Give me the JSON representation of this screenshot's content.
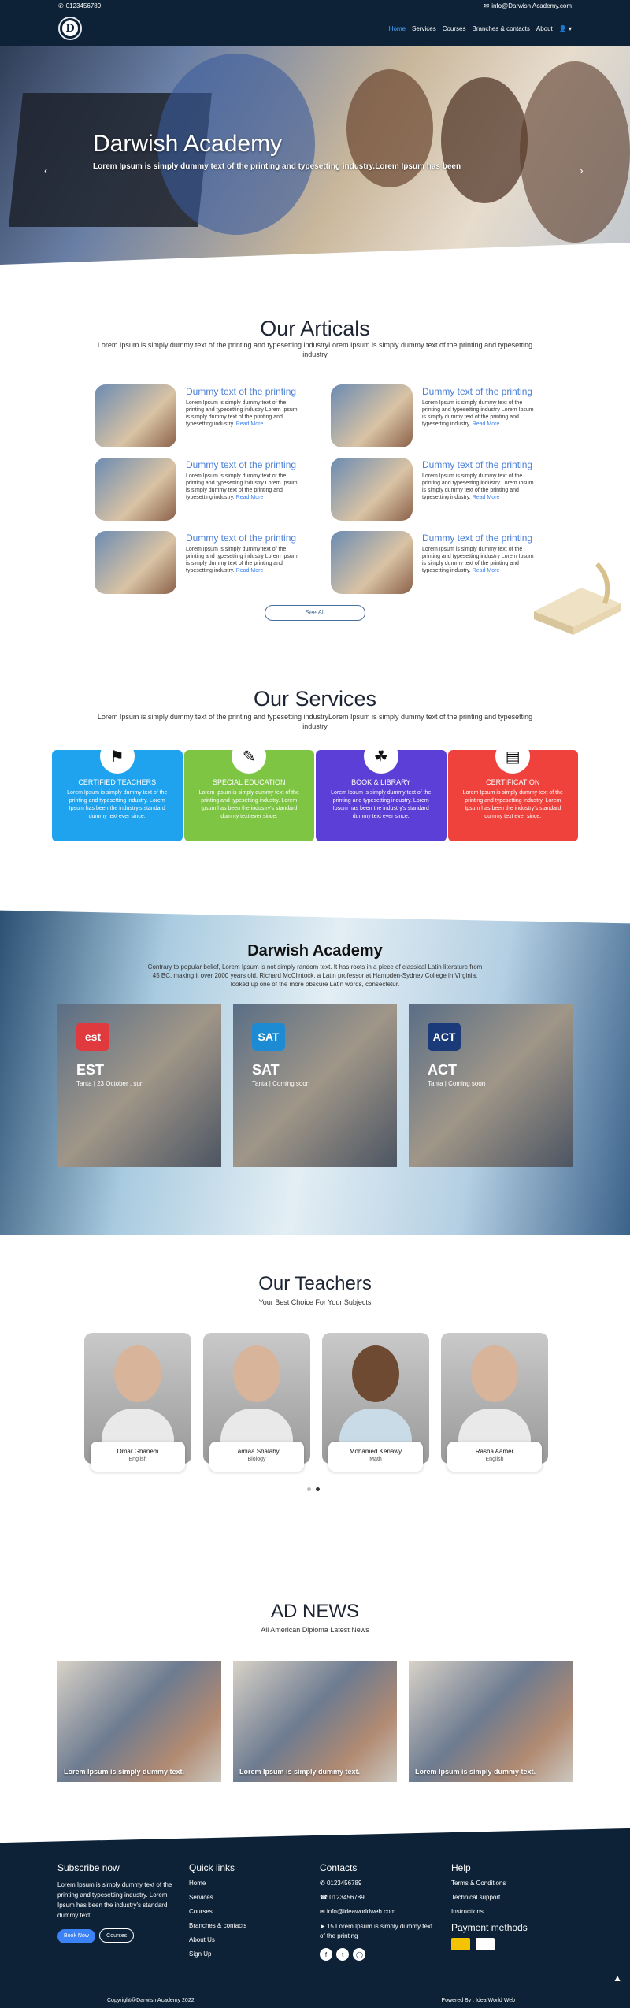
{
  "topbar": {
    "phone": "0123456789",
    "email": "info@Darwish Academy.com"
  },
  "nav": {
    "logo_letter": "D",
    "items": [
      "Home",
      "Services",
      "Courses",
      "Branches & contacts",
      "About"
    ],
    "user_icon": "user-icon"
  },
  "hero": {
    "title": "Darwish Academy",
    "subtitle": "Lorem Ipsum is simply dummy text of the printing and typesetting industry.Lorem Ipsum has been"
  },
  "articles": {
    "title": "Our Articals",
    "subtitle": "Lorem Ipsum is simply dummy text of the printing and typesetting industryLorem Ipsum is simply dummy text of the printing and typesetting industry",
    "items": [
      {
        "title": "Dummy text of the printing",
        "text": "Lorem Ipsum is simply dummy text of the printing and typesetting industry Lorem Ipsum is simply dummy text of the printing and typesetting industry.",
        "link": "Read More"
      },
      {
        "title": "Dummy text of the printing",
        "text": "Lorem Ipsum is simply dummy text of the printing and typesetting industry Lorem Ipsum is simply dummy text of the printing and typesetting industry.",
        "link": "Read More"
      },
      {
        "title": "Dummy text of the printing",
        "text": "Lorem Ipsum is simply dummy text of the printing and typesetting industry Lorem Ipsum is simply dummy text of the printing and typesetting industry.",
        "link": "Read More"
      },
      {
        "title": "Dummy text of the printing",
        "text": "Lorem Ipsum is simply dummy text of the printing and typesetting industry Lorem Ipsum is simply dummy text of the printing and typesetting industry.",
        "link": "Read More"
      },
      {
        "title": "Dummy text of the printing",
        "text": "Lorem Ipsum is simply dummy text of the printing and typesetting industry Lorem Ipsum is simply dummy text of the printing and typesetting industry.",
        "link": "Read More"
      },
      {
        "title": "Dummy text of the printing",
        "text": "Lorem Ipsum is simply dummy text of the printing and typesetting industry Lorem Ipsum is simply dummy text of the printing and typesetting industry.",
        "link": "Read More"
      }
    ],
    "see_all": "See All"
  },
  "services": {
    "title": "Our Services",
    "subtitle": "Lorem Ipsum is simply dummy text of the printing and typesetting industryLorem Ipsum is simply dummy text of the printing and typesetting industry",
    "items": [
      {
        "title": "CERTIFIED TEACHERS",
        "text": "Lorem Ipsum is simply dummy text of the printing and typesetting industry. Lorem Ipsum has been the industry's standard dummy text ever since.",
        "color": "#1fa3ee",
        "icon": "teacher-icon"
      },
      {
        "title": "SPECIAL EDUCATION",
        "text": "Lorem Ipsum is simply dummy text of the printing and typesetting industry. Lorem Ipsum has been the industry's standard dummy text ever since.",
        "color": "#7ec544",
        "icon": "reading-icon"
      },
      {
        "title": "BOOK & LIBRARY",
        "text": "Lorem Ipsum is simply dummy text of the printing and typesetting industry. Lorem Ipsum has been the industry's standard dummy text ever since.",
        "color": "#5b3fd6",
        "icon": "apple-books-icon"
      },
      {
        "title": "CERTIFICATION",
        "text": "Lorem Ipsum is simply dummy text of the printing and typesetting industry. Lorem Ipsum has been the industry's standard dummy text ever since.",
        "color": "#f0423c",
        "icon": "certificate-icon"
      }
    ]
  },
  "academy": {
    "title": "Darwish Academy",
    "text": "Contrary to popular belief, Lorem Ipsum is not simply random text. It has roots in a piece of classical Latin literature from 45 BC, making it over 2000 years old. Richard McClintock, a Latin professor at Hampden-Sydney College in Virginia, looked up one of the more obscure Latin words, consectetur.",
    "cards": [
      {
        "badge": "est",
        "title": "EST",
        "sub": "Tanta | 23 October , sun",
        "color": "#e03a3e"
      },
      {
        "badge": "SAT",
        "title": "SAT",
        "sub": "Tanta | Coming soon",
        "color": "#1c8bd4"
      },
      {
        "badge": "ACT",
        "title": "ACT",
        "sub": "Tanta | Coming soon",
        "color": "#1a3a7a"
      }
    ]
  },
  "teachers": {
    "title": "Our Teachers",
    "subtitle": "Your Best Choice For Your Subjects",
    "items": [
      {
        "name": "Omar Ghanem",
        "subject": "English"
      },
      {
        "name": "Lamiaa Shalaby",
        "subject": "Biology"
      },
      {
        "name": "Mohamed Kenawy",
        "subject": "Math"
      },
      {
        "name": "Rasha Aamer",
        "subject": "English"
      }
    ]
  },
  "news": {
    "title": "AD NEWS",
    "subtitle": "All American Diploma Latest News",
    "items": [
      "Lorem Ipsum is simply dummy text.",
      "Lorem Ipsum is simply dummy text.",
      "Lorem Ipsum is simply dummy text."
    ]
  },
  "footer": {
    "subscribe": {
      "title": "Subscribe now",
      "text": "Lorem Ipsum is simply dummy text of the printing and typesetting industry. Lorem Ipsum has been the industry's standard dummy text",
      "book_now": "Book Now",
      "courses": "Courses"
    },
    "quick": {
      "title": "Quick links",
      "items": [
        "Home",
        "Services",
        "Courses",
        "Branches & contacts",
        "About Us",
        "Sign Up"
      ]
    },
    "contacts": {
      "title": "Contacts",
      "phone": "0123456789",
      "whatsapp": "0123456789",
      "email": "info@ideaworldweb.com",
      "address": "15 Lorem Ipsum is simply dummy text of the printing"
    },
    "help": {
      "title": "Help",
      "items": [
        "Terms & Conditions",
        "Technical support",
        "Instructions"
      ],
      "payment_title": "Payment methods"
    },
    "copyright": "Copyright@Darwish Academy 2022",
    "powered": "Powered By : Idea World Web"
  }
}
